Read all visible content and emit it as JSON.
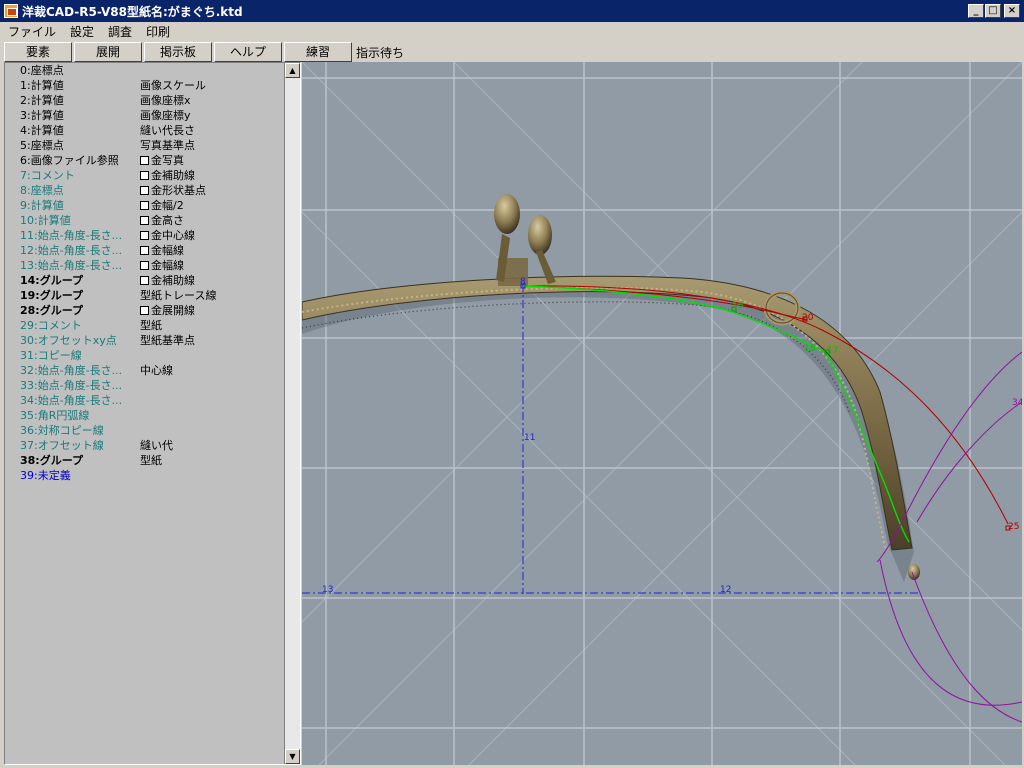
{
  "window": {
    "title": "洋裁CAD-R5-V88型紙名:がまぐち.ktd",
    "min_label": "_",
    "max_label": "□",
    "close_label": "×"
  },
  "menu": [
    "ファイル",
    "設定",
    "調査",
    "印刷"
  ],
  "toolbar": {
    "buttons": [
      "要素",
      "展開",
      "掲示板",
      "ヘルプ",
      "練習"
    ],
    "status": "指示待ち"
  },
  "tree": [
    {
      "label": "0:座標点",
      "sub": "",
      "style": "black",
      "check": false
    },
    {
      "label": "1:計算値",
      "sub": "画像スケール",
      "style": "black",
      "check": false
    },
    {
      "label": "2:計算値",
      "sub": "画像座標x",
      "style": "black",
      "check": false
    },
    {
      "label": "3:計算値",
      "sub": "画像座標y",
      "style": "black",
      "check": false
    },
    {
      "label": "4:計算値",
      "sub": "縫い代長さ",
      "style": "black",
      "check": false
    },
    {
      "label": "5:座標点",
      "sub": "写真基準点",
      "style": "black",
      "check": false
    },
    {
      "label": "6:画像ファイル参照",
      "sub": "金写真",
      "style": "black",
      "check": true
    },
    {
      "label": "7:コメント",
      "sub": "金補助線",
      "style": "teal",
      "check": true
    },
    {
      "label": "8:座標点",
      "sub": "金形状基点",
      "style": "teal",
      "check": true
    },
    {
      "label": "9:計算値",
      "sub": "金幅/2",
      "style": "teal",
      "check": true
    },
    {
      "label": "10:計算値",
      "sub": "金高さ",
      "style": "teal",
      "check": true
    },
    {
      "label": "11:始点-角度-長さ...",
      "sub": "金中心線",
      "style": "teal",
      "check": true
    },
    {
      "label": "12:始点-角度-長さ...",
      "sub": "金幅線",
      "style": "teal",
      "check": true
    },
    {
      "label": "13:始点-角度-長さ...",
      "sub": "金幅線",
      "style": "teal",
      "check": true
    },
    {
      "label": "14:グループ",
      "sub": "金補助線",
      "style": "bold",
      "check": true
    },
    {
      "label": "19:グループ",
      "sub": "型紙トレース線",
      "style": "bold",
      "check": false
    },
    {
      "label": "28:グループ",
      "sub": "金展開線",
      "style": "bold",
      "check": true
    },
    {
      "label": "29:コメント",
      "sub": "型紙",
      "style": "teal",
      "check": false
    },
    {
      "label": "30:オフセットxy点",
      "sub": "型紙基準点",
      "style": "teal",
      "check": false
    },
    {
      "label": "31:コピー線",
      "sub": "",
      "style": "teal",
      "check": false
    },
    {
      "label": "32:始点-角度-長さ...",
      "sub": "中心線",
      "style": "teal",
      "check": false
    },
    {
      "label": "33:始点-角度-長さ...",
      "sub": "",
      "style": "teal",
      "check": false
    },
    {
      "label": "34:始点-角度-長さ...",
      "sub": "",
      "style": "teal",
      "check": false
    },
    {
      "label": "35:角R円弧線",
      "sub": "",
      "style": "teal",
      "check": false
    },
    {
      "label": "36:対称コピー線",
      "sub": "",
      "style": "teal",
      "check": false
    },
    {
      "label": "37:オフセット線",
      "sub": "縫い代",
      "style": "teal",
      "check": false
    },
    {
      "label": "38:グループ",
      "sub": "型紙",
      "style": "bold",
      "check": false
    },
    {
      "label": "39:未定義",
      "sub": "",
      "style": "blue",
      "check": false
    }
  ],
  "scroll": {
    "up_label": "▲",
    "down_label": "▼"
  },
  "canvas_labels": {
    "l8": "8",
    "l11": "11",
    "l12": "12",
    "l13": "13",
    "l16": "16",
    "l17": "17",
    "l18": "18",
    "l20": "20",
    "l25": "25",
    "l34": "34"
  },
  "colors": {
    "teal": "#1a7a7a",
    "blue": "#0000cc",
    "guide_blue": "#2020e0",
    "curve_red": "#b00000",
    "curve_green": "#00e000",
    "curve_purple": "#9010a0"
  }
}
